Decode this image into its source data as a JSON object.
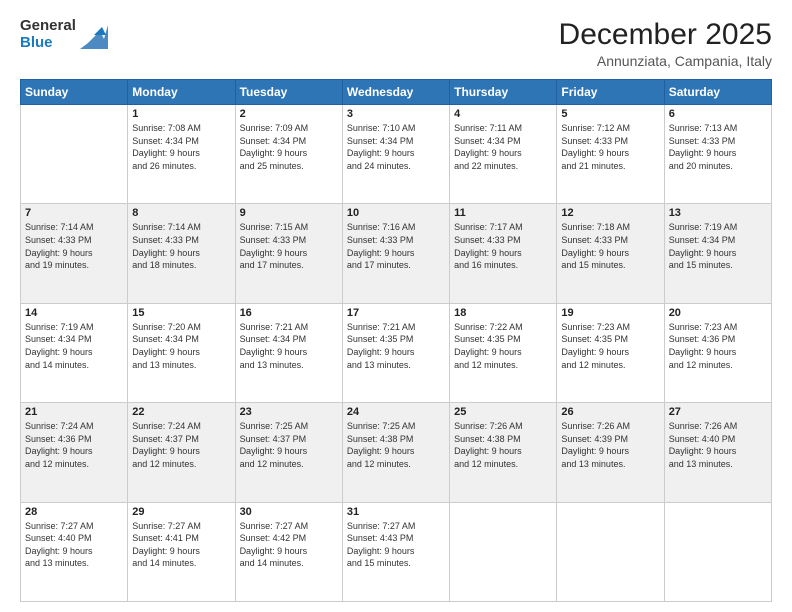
{
  "logo": {
    "general": "General",
    "blue": "Blue"
  },
  "header": {
    "month": "December 2025",
    "location": "Annunziata, Campania, Italy"
  },
  "weekdays": [
    "Sunday",
    "Monday",
    "Tuesday",
    "Wednesday",
    "Thursday",
    "Friday",
    "Saturday"
  ],
  "weeks": [
    [
      {
        "day": "",
        "info": ""
      },
      {
        "day": "1",
        "info": "Sunrise: 7:08 AM\nSunset: 4:34 PM\nDaylight: 9 hours\nand 26 minutes."
      },
      {
        "day": "2",
        "info": "Sunrise: 7:09 AM\nSunset: 4:34 PM\nDaylight: 9 hours\nand 25 minutes."
      },
      {
        "day": "3",
        "info": "Sunrise: 7:10 AM\nSunset: 4:34 PM\nDaylight: 9 hours\nand 24 minutes."
      },
      {
        "day": "4",
        "info": "Sunrise: 7:11 AM\nSunset: 4:34 PM\nDaylight: 9 hours\nand 22 minutes."
      },
      {
        "day": "5",
        "info": "Sunrise: 7:12 AM\nSunset: 4:33 PM\nDaylight: 9 hours\nand 21 minutes."
      },
      {
        "day": "6",
        "info": "Sunrise: 7:13 AM\nSunset: 4:33 PM\nDaylight: 9 hours\nand 20 minutes."
      }
    ],
    [
      {
        "day": "7",
        "info": "Sunrise: 7:14 AM\nSunset: 4:33 PM\nDaylight: 9 hours\nand 19 minutes."
      },
      {
        "day": "8",
        "info": "Sunrise: 7:14 AM\nSunset: 4:33 PM\nDaylight: 9 hours\nand 18 minutes."
      },
      {
        "day": "9",
        "info": "Sunrise: 7:15 AM\nSunset: 4:33 PM\nDaylight: 9 hours\nand 17 minutes."
      },
      {
        "day": "10",
        "info": "Sunrise: 7:16 AM\nSunset: 4:33 PM\nDaylight: 9 hours\nand 17 minutes."
      },
      {
        "day": "11",
        "info": "Sunrise: 7:17 AM\nSunset: 4:33 PM\nDaylight: 9 hours\nand 16 minutes."
      },
      {
        "day": "12",
        "info": "Sunrise: 7:18 AM\nSunset: 4:33 PM\nDaylight: 9 hours\nand 15 minutes."
      },
      {
        "day": "13",
        "info": "Sunrise: 7:19 AM\nSunset: 4:34 PM\nDaylight: 9 hours\nand 15 minutes."
      }
    ],
    [
      {
        "day": "14",
        "info": "Sunrise: 7:19 AM\nSunset: 4:34 PM\nDaylight: 9 hours\nand 14 minutes."
      },
      {
        "day": "15",
        "info": "Sunrise: 7:20 AM\nSunset: 4:34 PM\nDaylight: 9 hours\nand 13 minutes."
      },
      {
        "day": "16",
        "info": "Sunrise: 7:21 AM\nSunset: 4:34 PM\nDaylight: 9 hours\nand 13 minutes."
      },
      {
        "day": "17",
        "info": "Sunrise: 7:21 AM\nSunset: 4:35 PM\nDaylight: 9 hours\nand 13 minutes."
      },
      {
        "day": "18",
        "info": "Sunrise: 7:22 AM\nSunset: 4:35 PM\nDaylight: 9 hours\nand 12 minutes."
      },
      {
        "day": "19",
        "info": "Sunrise: 7:23 AM\nSunset: 4:35 PM\nDaylight: 9 hours\nand 12 minutes."
      },
      {
        "day": "20",
        "info": "Sunrise: 7:23 AM\nSunset: 4:36 PM\nDaylight: 9 hours\nand 12 minutes."
      }
    ],
    [
      {
        "day": "21",
        "info": "Sunrise: 7:24 AM\nSunset: 4:36 PM\nDaylight: 9 hours\nand 12 minutes."
      },
      {
        "day": "22",
        "info": "Sunrise: 7:24 AM\nSunset: 4:37 PM\nDaylight: 9 hours\nand 12 minutes."
      },
      {
        "day": "23",
        "info": "Sunrise: 7:25 AM\nSunset: 4:37 PM\nDaylight: 9 hours\nand 12 minutes."
      },
      {
        "day": "24",
        "info": "Sunrise: 7:25 AM\nSunset: 4:38 PM\nDaylight: 9 hours\nand 12 minutes."
      },
      {
        "day": "25",
        "info": "Sunrise: 7:26 AM\nSunset: 4:38 PM\nDaylight: 9 hours\nand 12 minutes."
      },
      {
        "day": "26",
        "info": "Sunrise: 7:26 AM\nSunset: 4:39 PM\nDaylight: 9 hours\nand 13 minutes."
      },
      {
        "day": "27",
        "info": "Sunrise: 7:26 AM\nSunset: 4:40 PM\nDaylight: 9 hours\nand 13 minutes."
      }
    ],
    [
      {
        "day": "28",
        "info": "Sunrise: 7:27 AM\nSunset: 4:40 PM\nDaylight: 9 hours\nand 13 minutes."
      },
      {
        "day": "29",
        "info": "Sunrise: 7:27 AM\nSunset: 4:41 PM\nDaylight: 9 hours\nand 14 minutes."
      },
      {
        "day": "30",
        "info": "Sunrise: 7:27 AM\nSunset: 4:42 PM\nDaylight: 9 hours\nand 14 minutes."
      },
      {
        "day": "31",
        "info": "Sunrise: 7:27 AM\nSunset: 4:43 PM\nDaylight: 9 hours\nand 15 minutes."
      },
      {
        "day": "",
        "info": ""
      },
      {
        "day": "",
        "info": ""
      },
      {
        "day": "",
        "info": ""
      }
    ]
  ]
}
